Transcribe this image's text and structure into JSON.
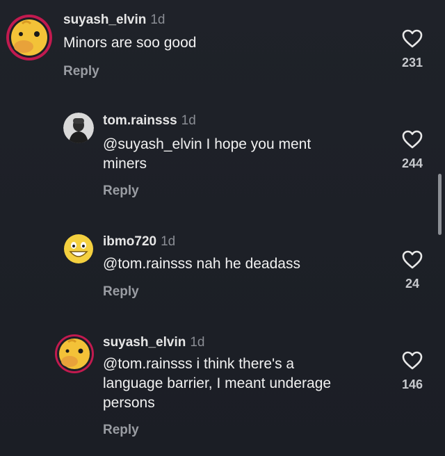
{
  "comments": [
    {
      "username": "suyash_elvin",
      "time": "1d",
      "text": "Minors are soo good",
      "reply_label": "Reply",
      "likes": "231",
      "avatar_icon": "duck-avatar-icon"
    },
    {
      "username": "tom.rainsss",
      "time": "1d",
      "text_line1": "@suyash_elvin I hope you ment",
      "text_line2": "miners",
      "reply_label": "Reply",
      "likes": "244",
      "avatar_icon": "photo-avatar-icon"
    },
    {
      "username": "ibmo720",
      "time": "1d",
      "text": "@tom.rainsss nah he deadass",
      "reply_label": "Reply",
      "likes": "24",
      "avatar_icon": "grinning-emoji-avatar-icon"
    },
    {
      "username": "suyash_elvin",
      "time": "1d",
      "text_line1": "@tom.rainsss i think there's a",
      "text_line2": "language barrier, I meant underage",
      "text_line3": "persons",
      "reply_label": "Reply",
      "likes": "146",
      "avatar_icon": "duck-avatar-icon"
    }
  ],
  "colors": {
    "background": "#1c1f26",
    "username": "#e6e6e6",
    "text": "#f1f1f1",
    "muted": "#8a8d94",
    "avatar_ring": "#c21a4f",
    "duck_yellow": "#f1c232"
  }
}
